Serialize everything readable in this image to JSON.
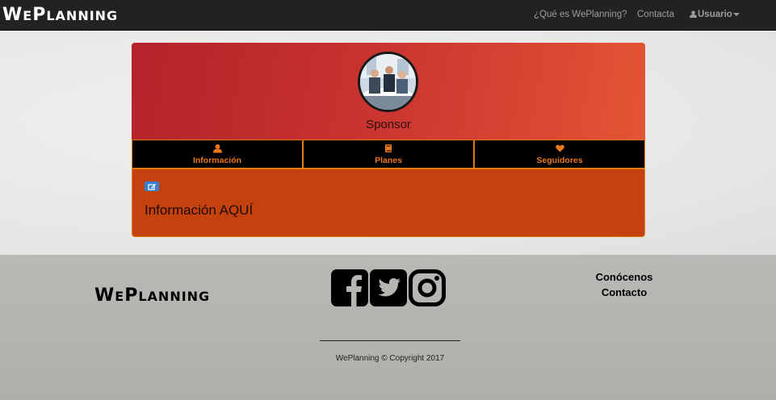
{
  "navbar": {
    "brand": {
      "w": "W",
      "e": "E",
      "p": "P",
      "rest": "LANNING"
    },
    "links": [
      {
        "label": "¿Qué es WePlanning?"
      },
      {
        "label": "Contacta"
      }
    ],
    "user_label": "Usuario"
  },
  "profile": {
    "name": "Sponsor",
    "tabs": [
      {
        "label": "Información",
        "icon": "user-icon"
      },
      {
        "label": "Planes",
        "icon": "book-icon"
      },
      {
        "label": "Seguidores",
        "icon": "heart-icon"
      }
    ],
    "info_text": "Información AQUÍ",
    "edit_icon": "edit-icon"
  },
  "footer": {
    "brand": {
      "w": "W",
      "e": "E",
      "p": "P",
      "rest": "LANNING"
    },
    "social": [
      "facebook-icon",
      "twitter-icon",
      "instagram-icon"
    ],
    "links": [
      {
        "label": "Conócenos"
      },
      {
        "label": "Contacto"
      }
    ],
    "copyright": "WePlanning © Copyright 2017"
  },
  "colors": {
    "navbar_bg": "#222222",
    "header_gradient_start": "#b3232a",
    "header_gradient_end": "#e35535",
    "tab_bg": "#000000",
    "tab_text": "#e8781a",
    "info_bg": "#c4420e",
    "edit_button": "#3a7fcf",
    "footer_bg": "#b5b5b2"
  }
}
